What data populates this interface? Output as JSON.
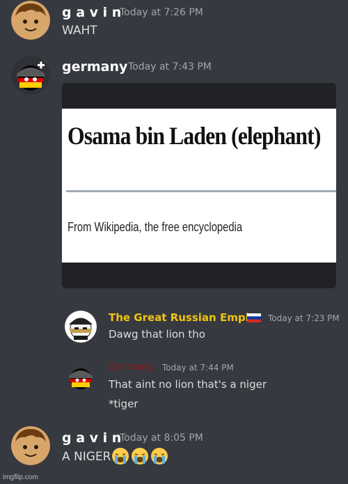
{
  "messages": [
    {
      "username": "g a v i n",
      "timestamp": "Today at 7:26 PM",
      "text": "WAHT"
    },
    {
      "username": "germany",
      "timestamp": "Today at 7:43 PM",
      "embed": {
        "title": "Osama bin Laden (elephant)",
        "subtitle": "From Wikipedia, the free encyclopedia"
      }
    }
  ],
  "quoted": [
    {
      "username": "The Great Russian Empire",
      "timestamp": "Today at 7:23 PM",
      "text": "Dawg that lion tho"
    },
    {
      "username": "Germany",
      "timestamp": "Today at 7:44 PM",
      "lines": [
        "That aint no lion that's a niger",
        "*tiger"
      ]
    }
  ],
  "last": {
    "username": "g a v i n",
    "timestamp": "Today at 8:05 PM",
    "text": "A NIGER"
  },
  "watermark": "imgflip.com",
  "colors": {
    "background": "#36393f",
    "username": "#ffffff",
    "timestamp": "#a3a6aa",
    "russian_name": "#f1c40f",
    "germany_red": "#8b1b1b"
  },
  "icons": [
    "avatar-gavin",
    "avatar-germany",
    "avatar-russian-empire",
    "russian-flag-icon",
    "loudly-crying-face-icon"
  ]
}
